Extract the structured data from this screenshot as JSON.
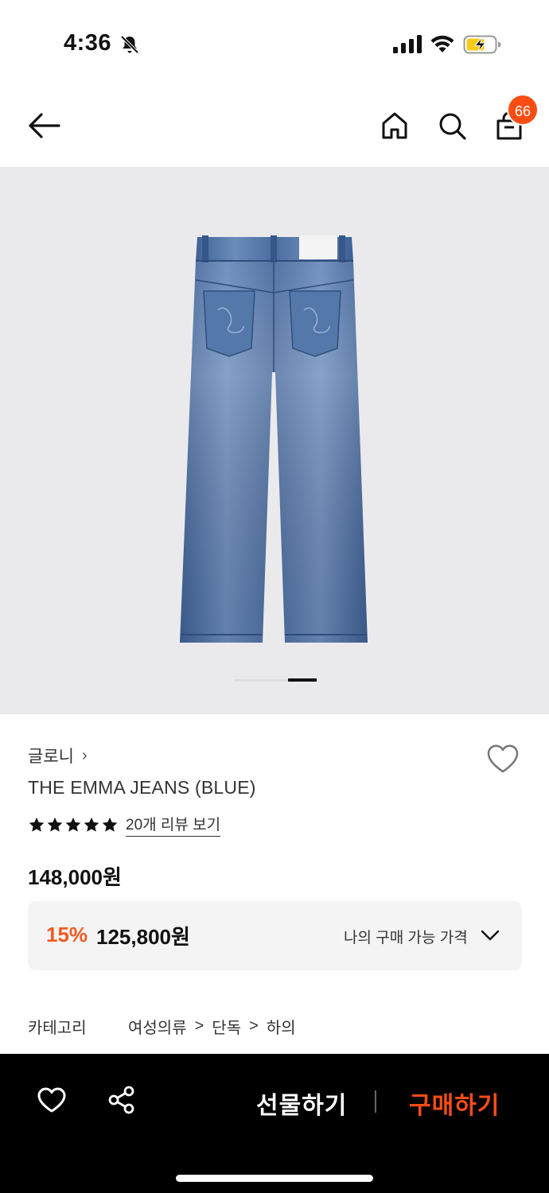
{
  "status_bar": {
    "time": "4:36"
  },
  "nav": {
    "cart_count": "66"
  },
  "product": {
    "brand": "글로니",
    "brand_chevron": "›",
    "name": "THE EMMA JEANS (BLUE)",
    "rating_stars": 5,
    "review_link": "20개 리뷰 보기",
    "original_price": "148,000원",
    "discount_rate": "15%",
    "discount_price": "125,800원",
    "my_price_label": "나의 구매 가능 가격",
    "category_label": "카테고리",
    "category_path": [
      "여성의류",
      "단독",
      "하의"
    ],
    "category_sep": ">"
  },
  "bottom_bar": {
    "gift_label": "선물하기",
    "buy_label": "구매하기"
  },
  "carousel": {
    "current_slide": 2,
    "total_slides": 2
  },
  "colors": {
    "accent": "#fb4d13",
    "hero_bg": "#eaeaec",
    "denim": "#4a6fa5"
  }
}
